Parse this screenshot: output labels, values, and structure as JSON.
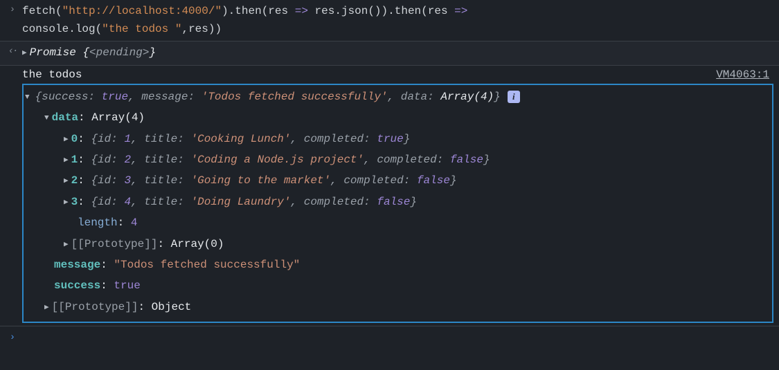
{
  "input": {
    "fn_fetch": "fetch",
    "paren_open": "(",
    "url": "\"http://localhost:4000/\"",
    "paren_close": ")",
    "dot_then1": ".then",
    "arrow1_params": "res",
    "arrow1_op": " => ",
    "arrow1_body_fn": "res.json",
    "dot_then2": ".then",
    "arrow2_params": "res",
    "arrow2_op": " =>",
    "line2_fn": "console.log",
    "line2_str": "\"the todos \"",
    "line2_comma": ",",
    "line2_arg": "res",
    "line2_close": "))"
  },
  "promise": {
    "label": "Promise ",
    "open": "{",
    "pending": "<pending>",
    "close": "}"
  },
  "log": {
    "prefix": "the todos ",
    "source": "VM4063:1",
    "summary": {
      "brace_open": "{",
      "k1": "success:",
      "v1": "true",
      "sep": ", ",
      "k2": "message:",
      "v2": "'Todos fetched successfully'",
      "k3": "data:",
      "v3": "Array(4)",
      "brace_close": "}"
    },
    "data_label": "data",
    "data_type": "Array(4)",
    "items": [
      {
        "idx": "0",
        "id": "1",
        "title": "'Cooking Lunch'",
        "completed": "true"
      },
      {
        "idx": "1",
        "id": "2",
        "title": "'Coding a Node.js project'",
        "completed": "false"
      },
      {
        "idx": "2",
        "id": "3",
        "title": "'Going to the market'",
        "completed": "false"
      },
      {
        "idx": "3",
        "id": "4",
        "title": "'Doing Laundry'",
        "completed": "false"
      }
    ],
    "length_key": "length",
    "length_val": "4",
    "proto_arr_key": "[[Prototype]]",
    "proto_arr_val": "Array(0)",
    "message_key": "message",
    "message_val": "\"Todos fetched successfully\"",
    "success_key": "success",
    "success_val": "true",
    "proto_obj_key": "[[Prototype]]",
    "proto_obj_val": "Object",
    "item_keys": {
      "id": "id",
      "title": "title",
      "completed": "completed"
    }
  },
  "glyphs": {
    "info": "i"
  }
}
